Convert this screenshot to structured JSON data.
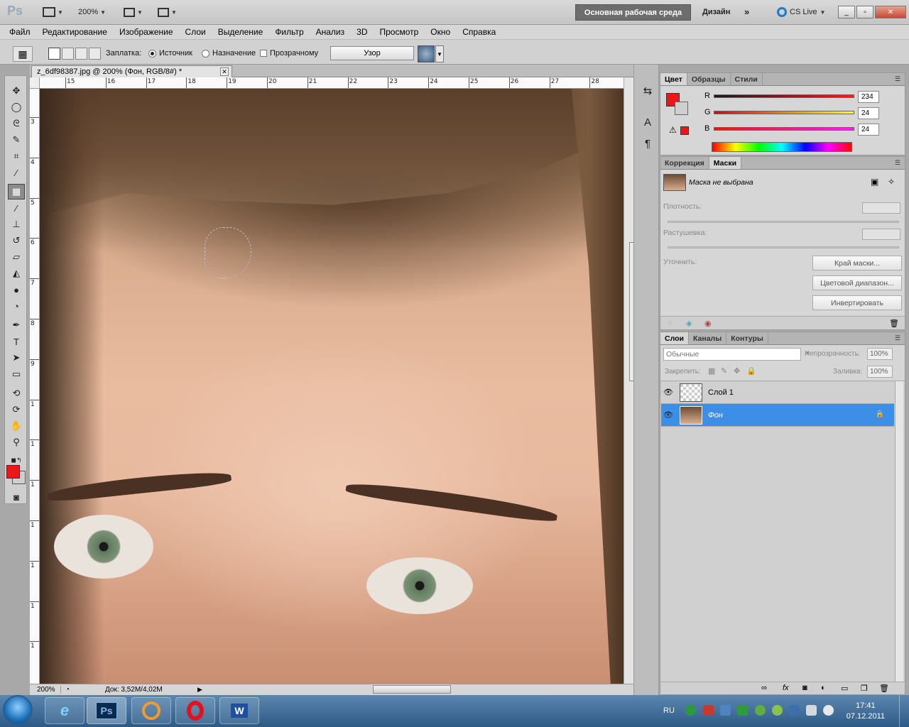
{
  "appbar": {
    "logo": "Ps",
    "zoom": "200%",
    "workspace_active": "Основная рабочая среда",
    "workspace_design": "Дизайн",
    "workspace_more": "»",
    "cslive": "CS Live",
    "window_controls": [
      "_",
      "▫",
      "✕"
    ]
  },
  "menu": [
    "Файл",
    "Редактирование",
    "Изображение",
    "Слои",
    "Выделение",
    "Фильтр",
    "Анализ",
    "3D",
    "Просмотр",
    "Окно",
    "Справка"
  ],
  "options": {
    "patch_label": "Заплатка:",
    "source_label": "Источник",
    "destination_label": "Назначение",
    "transparent_label": "Прозрачному",
    "pattern_button": "Узор"
  },
  "document": {
    "tab_title": "z_6df98387.jpg @ 200% (Фон, RGB/8#) *",
    "tab_close": "✕",
    "ruler_h": [
      "15",
      "16",
      "17",
      "18",
      "19",
      "20",
      "21",
      "22",
      "23",
      "24",
      "25",
      "26",
      "27",
      "28"
    ],
    "ruler_v": [
      "3",
      "4",
      "5",
      "6",
      "7",
      "8",
      "9",
      "1",
      "1",
      "1",
      "1",
      "1",
      "1",
      "1"
    ],
    "status_zoom": "200%",
    "status_doc": "Док: 3,52М/4,02М"
  },
  "tool_icons": [
    "move-icon",
    "marquee-icon",
    "lasso-icon",
    "quick-select-icon",
    "crop-icon",
    "eyedropper-icon",
    "patch-icon",
    "brush-icon",
    "stamp-icon",
    "history-brush-icon",
    "eraser-icon",
    "bucket-icon",
    "blur-icon",
    "dodge-icon",
    "pen-icon",
    "type-icon",
    "path-select-icon",
    "rectangle-icon",
    "3d-rotate-icon",
    "3d-orbit-icon",
    "hand-icon",
    "zoom-icon"
  ],
  "colors": {
    "foreground": "#ea1818",
    "background": "#cfcfcf",
    "selected_layer": "#3c8ee6"
  },
  "color_panel": {
    "tabs": [
      "Цвет",
      "Образцы",
      "Стили"
    ],
    "r_label": "R",
    "r_value": "234",
    "g_label": "G",
    "g_value": "24",
    "b_label": "B",
    "b_value": "24"
  },
  "masks_panel": {
    "tabs": [
      "Коррекция",
      "Маски"
    ],
    "mask_status": "Маска не выбрана",
    "density_label": "Плотность:",
    "feather_label": "Растушевка:",
    "refine_label": "Уточнить:",
    "btn_mask_edge": "Край маски...",
    "btn_color_range": "Цветовой диапазон...",
    "btn_invert": "Инвертировать"
  },
  "layers_panel": {
    "tabs": [
      "Слои",
      "Каналы",
      "Контуры"
    ],
    "blend_mode": "Обычные",
    "opacity_label": "Непрозрачность:",
    "opacity_value": "100%",
    "lock_label": "Закрепить:",
    "fill_label": "Заливка:",
    "fill_value": "100%",
    "layers": [
      {
        "name": "Слой 1",
        "selected": false
      },
      {
        "name": "Фон",
        "selected": true
      }
    ]
  },
  "taskbar": {
    "apps": [
      "ie-icon",
      "photoshop-icon",
      "mail-icon",
      "opera-icon",
      "word-icon"
    ],
    "ps_label": "Ps",
    "word_label": "W",
    "lang": "RU",
    "time": "17:41",
    "date": "07.12.2011"
  }
}
